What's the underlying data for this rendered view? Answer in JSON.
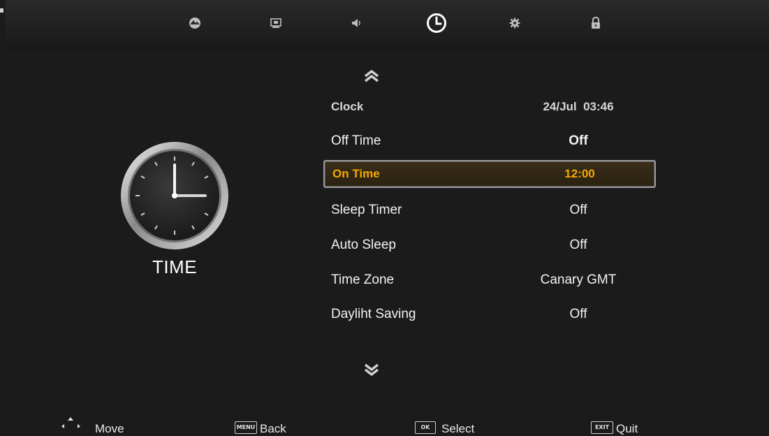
{
  "top_menu": {
    "icons": [
      {
        "name": "picture-icon"
      },
      {
        "name": "display-icon"
      },
      {
        "name": "sound-icon"
      },
      {
        "name": "time-icon",
        "active": true
      },
      {
        "name": "settings-icon"
      },
      {
        "name": "lock-icon"
      }
    ]
  },
  "left": {
    "title": "TIME"
  },
  "menu": {
    "rows": [
      {
        "label": "Clock",
        "value": "24/Jul  03:46"
      },
      {
        "label": "Off Time",
        "value": "Off"
      },
      {
        "label": "On Time",
        "value": "12:00",
        "selected": true
      },
      {
        "label": "Sleep Timer",
        "value": "Off"
      },
      {
        "label": "Auto Sleep",
        "value": "Off"
      },
      {
        "label": "Time Zone",
        "value": "Canary GMT"
      },
      {
        "label": "Dayliht Saving",
        "value": "Off"
      }
    ]
  },
  "bottom": {
    "move": "Move",
    "menu_key": "MENU",
    "back": "Back",
    "ok_key": "OK",
    "select": "Select",
    "exit_key": "EXIT",
    "quit": "Quit"
  },
  "colors": {
    "background": "#1b1b1b",
    "selected_text": "#f5a800",
    "text": "#f2f2f2"
  }
}
